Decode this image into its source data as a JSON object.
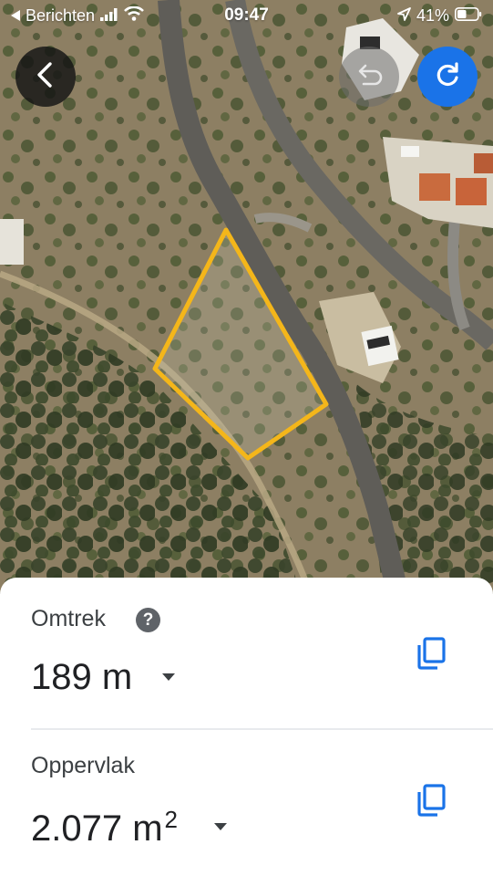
{
  "status_bar": {
    "back_app": "Berichten",
    "time": "09:47",
    "battery": "41%"
  },
  "map": {
    "back_icon": "chevron-left-icon",
    "undo_icon": "undo-icon",
    "redo_icon": "redo-icon",
    "outline_color": "#f4b61a"
  },
  "measurements": {
    "perimeter": {
      "label": "Omtrek",
      "value": "189 m",
      "help_glyph": "?",
      "copy_icon": "copy-icon",
      "dropdown_icon": "dropdown-arrow-icon"
    },
    "area": {
      "label": "Oppervlak",
      "value": "2.077 m",
      "unit_superscript": "2",
      "copy_icon": "copy-icon",
      "dropdown_icon": "dropdown-arrow-icon"
    }
  },
  "colors": {
    "accent": "#1a73e8",
    "sheet_bg": "#ffffff",
    "text_primary": "#202124",
    "text_secondary": "#3c4043"
  }
}
